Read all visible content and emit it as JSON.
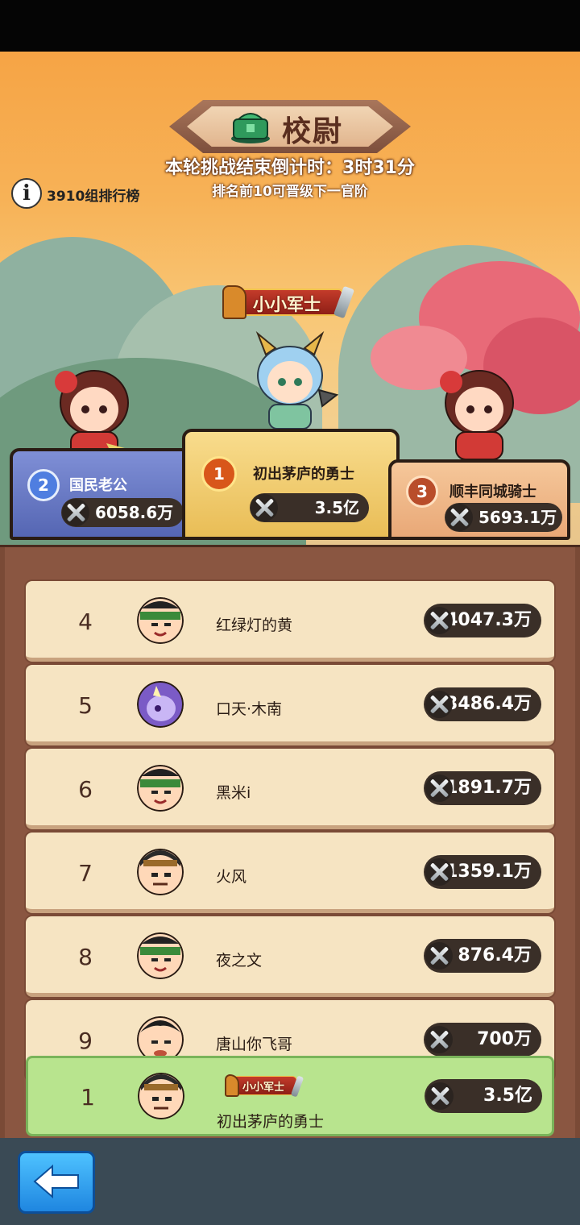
{
  "header": {
    "rank_title": "校尉",
    "countdown": "本轮挑战结束倒计时：3时31分",
    "promotion_rule": "排名前10可晋级下一官阶",
    "group_label": "3910组排行榜"
  },
  "podium": {
    "first": {
      "medal": "1",
      "title_badge": "小小军士",
      "name": "初出茅庐的勇士",
      "power": "3.5亿"
    },
    "second": {
      "medal": "2",
      "name": "国民老公",
      "power": "6058.6万"
    },
    "third": {
      "medal": "3",
      "name": "顺丰同城骑士",
      "power": "5693.1万"
    }
  },
  "ranking": [
    {
      "rank": "4",
      "name": "红绿灯的黄",
      "power": "4047.3万"
    },
    {
      "rank": "5",
      "name": "口天·木南",
      "power": "3486.4万"
    },
    {
      "rank": "6",
      "name": "黑米i",
      "power": "1891.7万"
    },
    {
      "rank": "7",
      "name": "火风",
      "power": "1359.1万"
    },
    {
      "rank": "8",
      "name": "夜之文",
      "power": "876.4万"
    },
    {
      "rank": "9",
      "name": "唐山你飞哥",
      "power": "700万"
    }
  ],
  "my_entry": {
    "rank": "1",
    "title_badge": "小小军士",
    "name": "初出茅庐的勇士",
    "power": "3.5亿"
  },
  "colors": {
    "sky": "#f6a445",
    "panel": "#7a4a36",
    "row": "#f6e4c2",
    "my_row": "#b8e48e",
    "back_button": "#2a95ee"
  }
}
